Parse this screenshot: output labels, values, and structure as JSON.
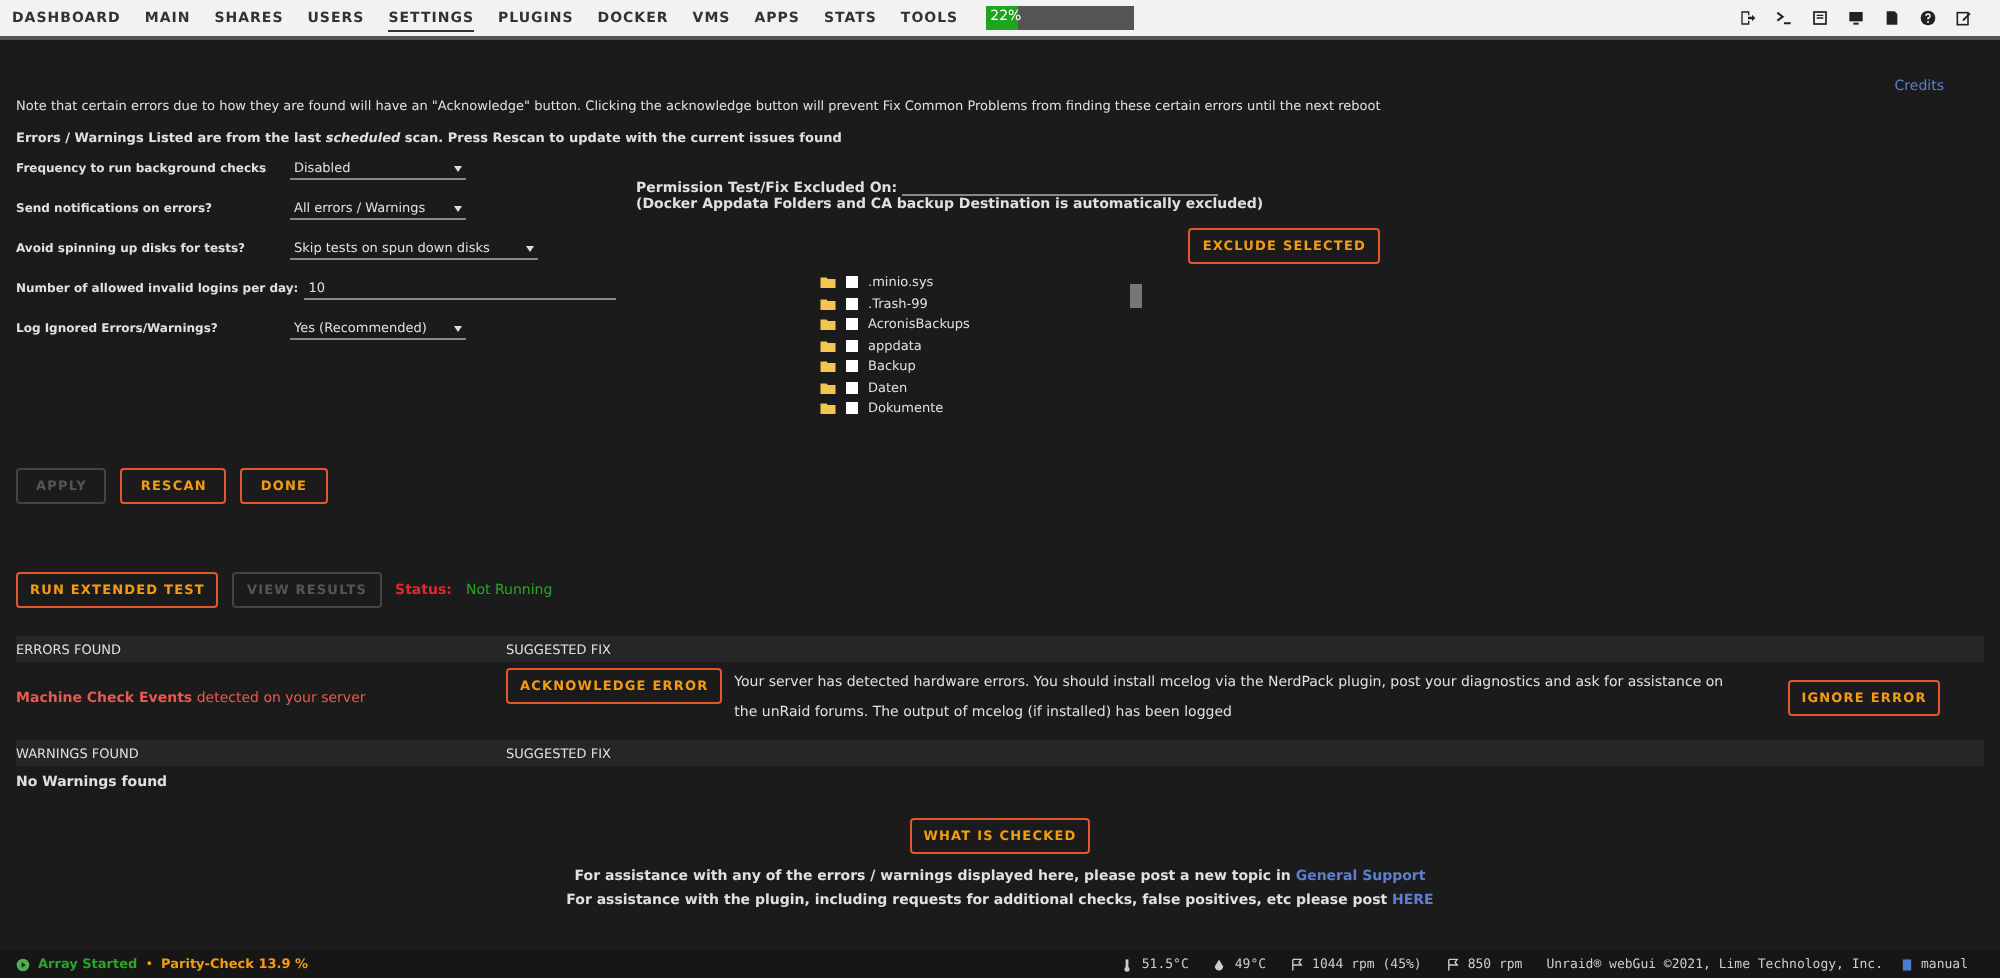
{
  "nav": {
    "items": [
      {
        "label": "DASHBOARD",
        "selected": false
      },
      {
        "label": "MAIN",
        "selected": false
      },
      {
        "label": "SHARES",
        "selected": false
      },
      {
        "label": "USERS",
        "selected": false
      },
      {
        "label": "SETTINGS",
        "selected": true
      },
      {
        "label": "PLUGINS",
        "selected": false
      },
      {
        "label": "DOCKER",
        "selected": false
      },
      {
        "label": "VMS",
        "selected": false
      },
      {
        "label": "APPS",
        "selected": false
      },
      {
        "label": "STATS",
        "selected": false
      },
      {
        "label": "TOOLS",
        "selected": false
      }
    ],
    "progress": {
      "text": "22%",
      "level": 0.22
    }
  },
  "credits": "Credits",
  "note": "Note that certain errors due to how they are found will have an \"Acknowledge\" button. Clicking the acknowledge button will prevent Fix Common Problems from finding these certain errors until the next reboot",
  "scan_note": "Errors / Warnings Listed are from the last *scheduled* scan. Press Rescan to update with the current issues found",
  "settings": [
    {
      "label": "Frequency to run background checks",
      "value": "Disabled",
      "kind": "select"
    },
    {
      "label": "Send notifications on errors?",
      "value": "All errors / Warnings",
      "kind": "select"
    },
    {
      "label": "Avoid spinning up disks for tests?",
      "value": "Skip tests on spun down disks",
      "kind": "select"
    },
    {
      "label": "Number of allowed invalid logins per day:",
      "value": "10",
      "kind": "input"
    },
    {
      "label": "Log Ignored Errors/Warnings?",
      "value": "Yes (Recommended)",
      "kind": "select"
    }
  ],
  "exclusion": {
    "label": "Permission Test/Fix Excluded On:",
    "hint": "(Docker Appdata Folders and CA backup Destination is automatically excluded)",
    "button": "EXCLUDE SELECTED",
    "folders": [
      {
        "name": ".minio.sys",
        "checked": false
      },
      {
        "name": ".Trash-99",
        "checked": false
      },
      {
        "name": "AcronisBackups",
        "checked": false
      },
      {
        "name": "appdata",
        "checked": false
      },
      {
        "name": "Backup",
        "checked": false
      },
      {
        "name": "Daten",
        "checked": false
      },
      {
        "name": "Dokumente",
        "checked": false
      }
    ]
  },
  "actions": [
    {
      "label": "APPLY",
      "disabled": true
    },
    {
      "label": "RESCAN",
      "disabled": false
    },
    {
      "label": "DONE",
      "disabled": false
    }
  ],
  "extended": {
    "buttons": [
      {
        "label": "RUN EXTENDED TEST",
        "disabled": false
      },
      {
        "label": "VIEW RESULTS",
        "disabled": true
      }
    ],
    "status_label": "Status:",
    "status": "Not Running"
  },
  "errors": {
    "columns": [
      "ERRORS FOUND",
      "SUGGESTED FIX"
    ],
    "rows": [
      {
        "error": "**Machine Check Events** detected on your server",
        "ack": "ACKNOWLEDGE ERROR",
        "fix": "Your server has detected hardware errors. You should install mcelog via the NerdPack plugin, post your diagnostics and ask for assistance on the unRaid forums. The output of mcelog (if installed) has been logged",
        "ignore": "IGNORE ERROR"
      }
    ]
  },
  "warnings": {
    "columns": [
      "WARNINGS FOUND",
      "SUGGESTED FIX"
    ],
    "empty": "No Warnings found"
  },
  "what_checked": "WHAT IS CHECKED",
  "help": [
    {
      "text": "For assistance with any of the errors / warnings displayed here, please post a new topic in",
      "link": "General Support"
    },
    {
      "text": "For assistance with the plugin, including requests for additional checks, false positives, etc please post",
      "link": "HERE"
    }
  ],
  "status_bar": {
    "array": "Array Started",
    "sep": "•",
    "parity": "Parity-Check 13.9 %",
    "sensors": [
      {
        "kind": "cpu",
        "text": "51.5°C"
      },
      {
        "kind": "temp",
        "text": "49°C"
      },
      {
        "kind": "fan",
        "text": "1044 rpm (45%)"
      },
      {
        "kind": "fan",
        "text": "850 rpm"
      }
    ],
    "copyright": "Unraid® webGui ©2021, Lime Technology, Inc.",
    "manual": "manual"
  }
}
